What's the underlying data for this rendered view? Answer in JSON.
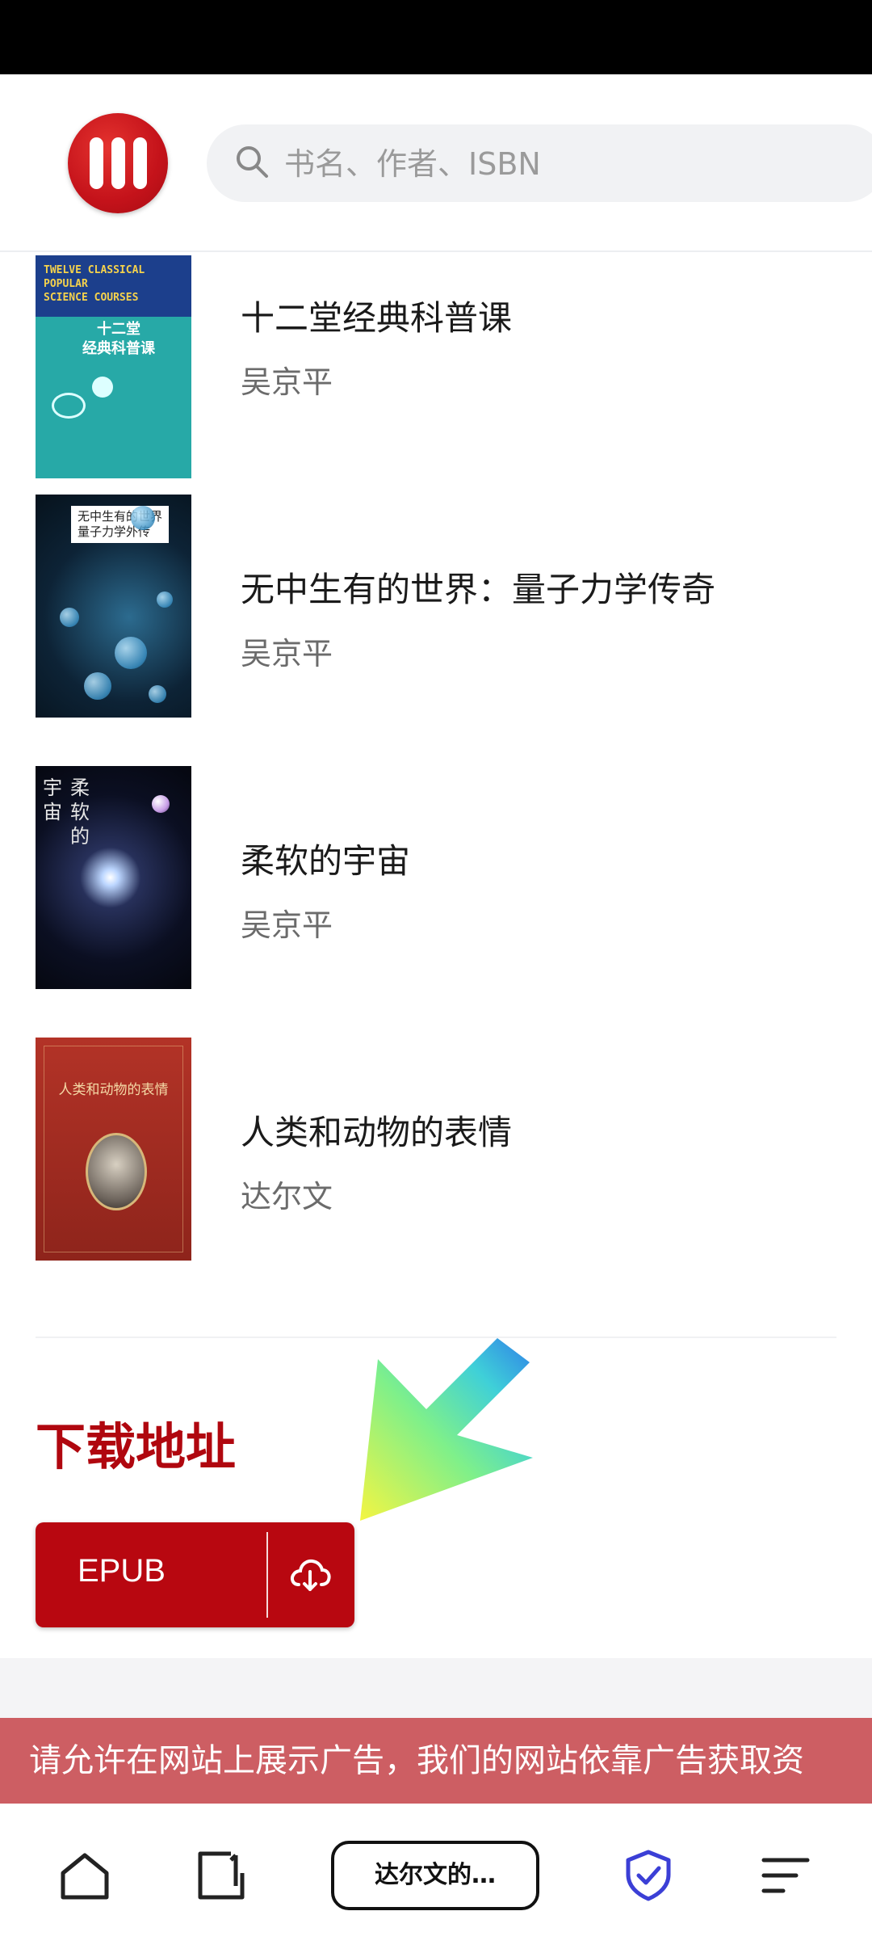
{
  "search": {
    "placeholder": "书名、作者、ISBN"
  },
  "books": [
    {
      "title": "十二堂经典科普课",
      "author": "吴京平",
      "cover": {
        "top_text": "TWELVE CLASSICAL\nPOPULAR\nSCIENCE COURSES",
        "title_text": "十二堂\n经典科普课"
      }
    },
    {
      "title": "无中生有的世界：量子力学传奇",
      "author": "吴京平",
      "cover": {
        "title_text": "无中生有的世界\n量子力学外传"
      }
    },
    {
      "title": "柔软的宇宙",
      "author": "吴京平",
      "cover": {
        "col1": "宇宙",
        "col2": "柔软的"
      }
    },
    {
      "title": "人类和动物的表情",
      "author": "达尔文",
      "cover": {
        "title_text": "人类和动物的表情"
      }
    }
  ],
  "download": {
    "title": "下载地址",
    "button_label": "EPUB"
  },
  "ad_banner": {
    "text": "请允许在网站上展示广告，我们的网站依靠广告获取资"
  },
  "nav": {
    "tab_label": "达尔文的…"
  },
  "colors": {
    "brand": "#b80710",
    "ad": "#cd5e63",
    "shield": "#3b3fd6"
  }
}
